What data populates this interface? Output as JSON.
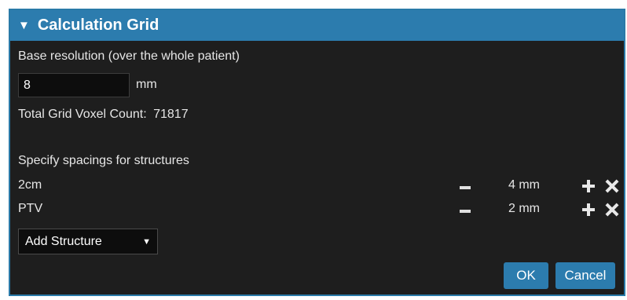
{
  "panel": {
    "title": "Calculation Grid"
  },
  "resolution": {
    "label": "Base resolution (over the whole patient)",
    "value": "8",
    "unit": "mm"
  },
  "voxel_count": {
    "label": "Total Grid Voxel Count:",
    "value": "71817"
  },
  "structures": {
    "heading": "Specify spacings for structures",
    "rows": [
      {
        "name": "2cm",
        "value": "4 mm"
      },
      {
        "name": "PTV",
        "value": "2 mm"
      }
    ],
    "add_select": "Add Structure"
  },
  "buttons": {
    "ok": "OK",
    "cancel": "Cancel"
  },
  "colors": {
    "accent": "#2c7cae",
    "background": "#1e1e1e"
  }
}
